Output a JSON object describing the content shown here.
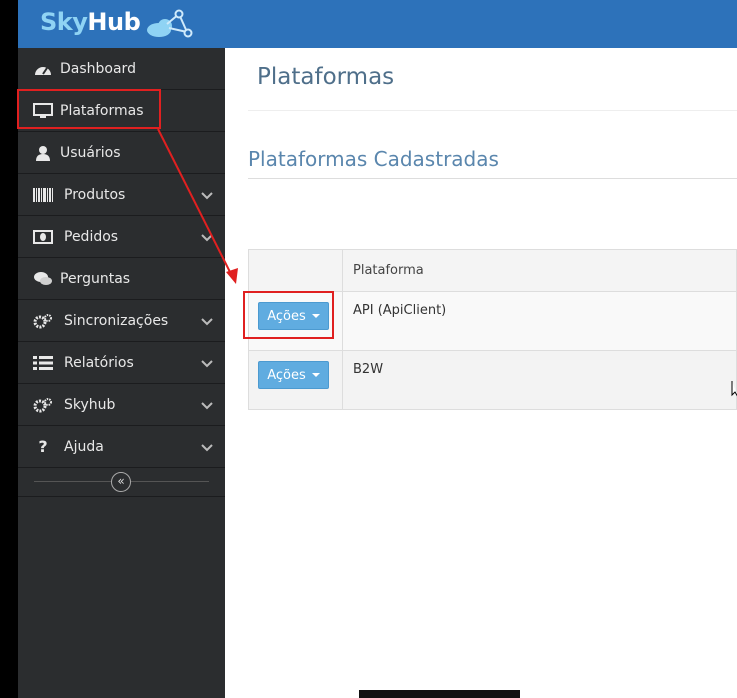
{
  "app": {
    "logo_part1": "Sky",
    "logo_part2": "Hub"
  },
  "sidebar": {
    "items": [
      {
        "label": "Dashboard",
        "icon": "dashboard-icon"
      },
      {
        "label": "Plataformas",
        "icon": "monitor-icon"
      },
      {
        "label": "Usuários",
        "icon": "user-icon"
      },
      {
        "label": "Produtos",
        "icon": "barcode-icon",
        "expandable": true
      },
      {
        "label": "Pedidos",
        "icon": "money-icon",
        "expandable": true
      },
      {
        "label": "Perguntas",
        "icon": "comments-icon"
      },
      {
        "label": "Sincronizações",
        "icon": "cogs-icon",
        "expandable": true
      },
      {
        "label": "Relatórios",
        "icon": "list-icon",
        "expandable": true
      },
      {
        "label": "Skyhub",
        "icon": "cogs-icon",
        "expandable": true
      },
      {
        "label": "Ajuda",
        "icon": "question-icon",
        "expandable": true
      }
    ],
    "collapse_glyph": "«"
  },
  "main": {
    "page_title": "Plataformas",
    "section_title": "Plataformas Cadastradas",
    "table": {
      "header": [
        "",
        "Plataforma"
      ],
      "rows": [
        {
          "action_label": "Ações",
          "plataforma": "API (ApiClient)"
        },
        {
          "action_label": "Ações",
          "plataforma": "B2W"
        }
      ]
    }
  },
  "colors": {
    "topbar": "#2d72ba",
    "sidebar": "#2b2d2f",
    "button": "#60ace0",
    "highlight": "#e02020"
  }
}
